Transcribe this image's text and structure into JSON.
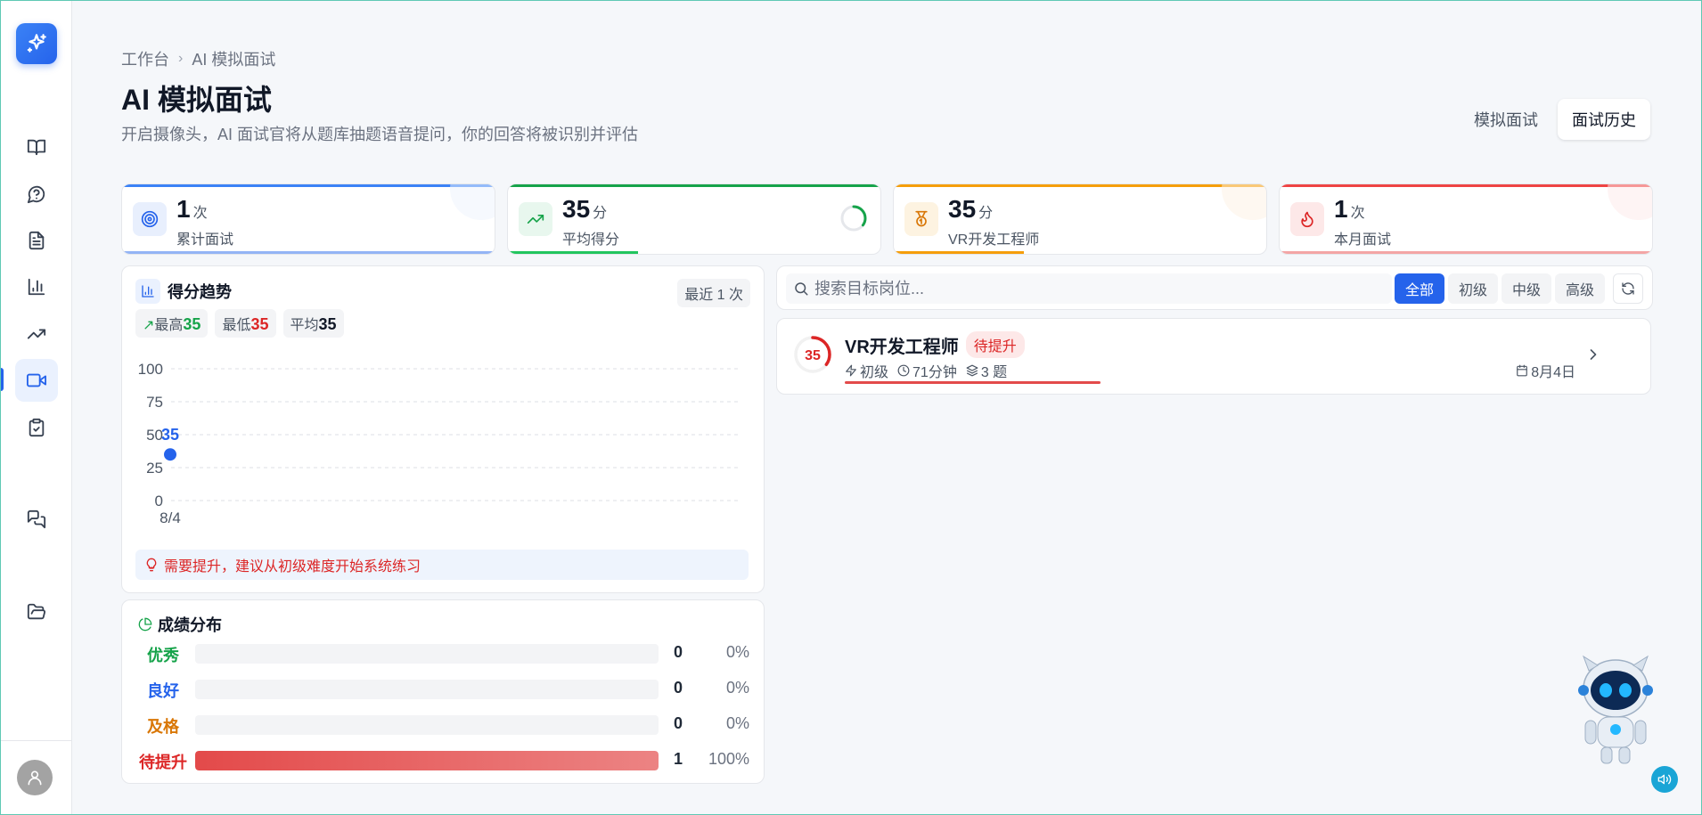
{
  "breadcrumb": {
    "root": "工作台",
    "current": "AI 模拟面试"
  },
  "header": {
    "title": "AI 模拟面试",
    "subtitle": "开启摄像头，AI 面试官将从题库抽题语音提问，你的回答将被识别并评估"
  },
  "tabs": [
    {
      "label": "模拟面试",
      "active": false
    },
    {
      "label": "面试历史",
      "active": true
    }
  ],
  "stats": [
    {
      "value": "1",
      "unit": "次",
      "label": "累计面试",
      "color": "#3b82f6",
      "icon": "target-icon"
    },
    {
      "value": "35",
      "unit": "分",
      "label": "平均得分",
      "color": "#16a34a",
      "icon": "trending-up-icon",
      "progress": 0.35
    },
    {
      "value": "35",
      "unit": "分",
      "label": "VR开发工程师",
      "color": "#f59e0b",
      "icon": "medal-icon",
      "progress": 0.35
    },
    {
      "value": "1",
      "unit": "次",
      "label": "本月面试",
      "color": "#ef4444",
      "icon": "flame-icon"
    }
  ],
  "trend": {
    "title": "得分趋势",
    "range": "最近 1 次",
    "max_label": "最高",
    "max_value": "35",
    "min_label": "最低",
    "min_value": "35",
    "avg_label": "平均",
    "avg_value": "35",
    "tip": "需要提升，建议从初级难度开始系统练习"
  },
  "chart_data": {
    "type": "line",
    "x": [
      "8/4"
    ],
    "series": [
      {
        "values": [
          35
        ]
      }
    ],
    "yticks": [
      100,
      75,
      50,
      25,
      0
    ],
    "ylim": [
      0,
      100
    ],
    "grid": true,
    "data_labels": [
      "35"
    ]
  },
  "distribution": {
    "title": "成绩分布",
    "rows": [
      {
        "label": "优秀",
        "count": "0",
        "pct": "0%",
        "fraction": 0,
        "color": "#16a34a"
      },
      {
        "label": "良好",
        "count": "0",
        "pct": "0%",
        "fraction": 0,
        "color": "#2563eb"
      },
      {
        "label": "及格",
        "count": "0",
        "pct": "0%",
        "fraction": 0,
        "color": "#d97706"
      },
      {
        "label": "待提升",
        "count": "1",
        "pct": "100%",
        "fraction": 1,
        "color": "#dc2626"
      }
    ]
  },
  "search": {
    "placeholder": "搜索目标岗位...",
    "filters": [
      "全部",
      "初级",
      "中级",
      "高级"
    ],
    "active_filter": "全部"
  },
  "records": [
    {
      "score": "35",
      "score_fraction": 0.35,
      "title": "VR开发工程师",
      "badge": "待提升",
      "level": "初级",
      "duration": "71分钟",
      "questions": "3 题",
      "date": "8月4日"
    }
  ]
}
